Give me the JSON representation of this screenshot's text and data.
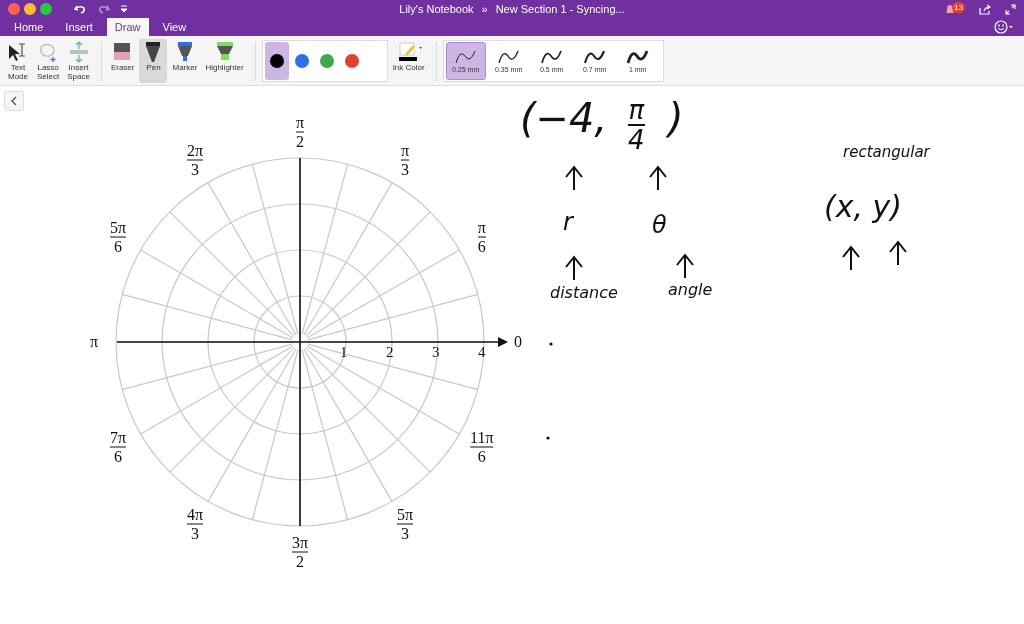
{
  "window": {
    "title": "Lily's Notebook",
    "separator": "»",
    "section": "New Section 1 - Syncing...",
    "notification_count": "13"
  },
  "tabs": [
    {
      "label": "Home",
      "selected": false
    },
    {
      "label": "Insert",
      "selected": false
    },
    {
      "label": "Draw",
      "selected": true
    },
    {
      "label": "View",
      "selected": false
    }
  ],
  "tools": [
    {
      "kind": "text",
      "label": "Text\nMode",
      "selected": false
    },
    {
      "kind": "lasso",
      "label": "Lasso\nSelect",
      "selected": false
    },
    {
      "kind": "space",
      "label": "Insert\nSpace",
      "selected": false
    },
    {
      "kind": "eraser",
      "label": "Eraser",
      "selected": false
    },
    {
      "kind": "pen",
      "label": "Pen",
      "selected": true
    },
    {
      "kind": "marker",
      "label": "Marker",
      "selected": false
    },
    {
      "kind": "highlighter",
      "label": "Highlighter",
      "selected": false
    }
  ],
  "pen_colors": [
    {
      "color": "#000000",
      "selected": true
    },
    {
      "color": "#2f6fe8",
      "selected": false
    },
    {
      "color": "#3fa84a",
      "selected": false
    },
    {
      "color": "#e0412f",
      "selected": false
    }
  ],
  "ink_color": {
    "label": "Ink Color"
  },
  "thickness": [
    {
      "label": "0.25 mm",
      "selected": true
    },
    {
      "label": "0.35 mm",
      "selected": false
    },
    {
      "label": "0.5 mm",
      "selected": false
    },
    {
      "label": "0.7 mm",
      "selected": false
    },
    {
      "label": "1 mm",
      "selected": false
    }
  ],
  "graph": {
    "angle_labels": [
      {
        "num": "0"
      },
      {
        "num": "π",
        "den": "6"
      },
      {
        "num": "π",
        "den": "3"
      },
      {
        "num": "π",
        "den": "2"
      },
      {
        "num": "2π",
        "den": "3"
      },
      {
        "num": "5π",
        "den": "6"
      },
      {
        "num": "π"
      },
      {
        "num": "7π",
        "den": "6"
      },
      {
        "num": "4π",
        "den": "3"
      },
      {
        "num": "3π",
        "den": "2"
      },
      {
        "num": "5π",
        "den": "3"
      },
      {
        "num": "11π",
        "den": "6"
      }
    ],
    "radius_ticks": [
      "1",
      "2",
      "3",
      "4"
    ]
  },
  "notes": [
    {
      "kind": "text",
      "text": "(−4,"
    },
    {
      "kind": "fraction",
      "num": "π",
      "den": "4"
    },
    {
      "kind": "text",
      "text": ")"
    },
    {
      "kind": "arrow"
    },
    {
      "kind": "arrow"
    },
    {
      "kind": "text",
      "text": "r"
    },
    {
      "kind": "text",
      "text": "θ"
    },
    {
      "kind": "arrow"
    },
    {
      "kind": "arrow"
    },
    {
      "kind": "text",
      "text": "distance"
    },
    {
      "kind": "text",
      "text": "angle"
    },
    {
      "kind": "text",
      "text": "rectangular"
    },
    {
      "kind": "text",
      "text": "(x, y)"
    },
    {
      "kind": "arrow"
    },
    {
      "kind": "arrow"
    },
    {
      "kind": "dot"
    },
    {
      "kind": "dot"
    }
  ]
}
